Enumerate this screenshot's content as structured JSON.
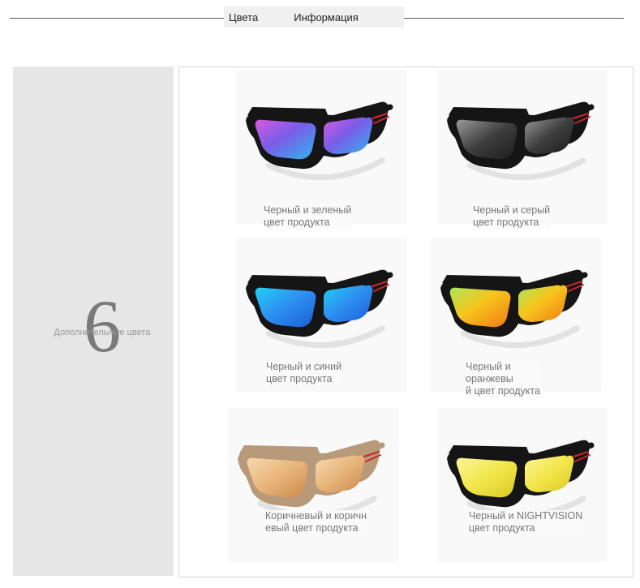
{
  "tabs": [
    "Цвета",
    "Информация"
  ],
  "side": {
    "count": "6",
    "caption": "Дополнительные цвета"
  },
  "products": [
    {
      "line1": "Черный и зеленый",
      "line2": "цвет продукта",
      "line3": "",
      "frame": "#151515",
      "lens": "purple-blue"
    },
    {
      "line1": "Черный и серый",
      "line2": "цвет продукта",
      "line3": "",
      "frame": "#151515",
      "lens": "grey"
    },
    {
      "line1": "Черный и синий",
      "line2": "цвет продукта",
      "line3": "",
      "frame": "#151515",
      "lens": "blue"
    },
    {
      "line1": "Черный и",
      "line2": "оранжевы",
      "line3": "й цвет продукта",
      "frame": "#151515",
      "lens": "orange"
    },
    {
      "line1": "Коричневый и коричн",
      "line2": "евый цвет продукта",
      "line3": "",
      "frame": "#b89a7a",
      "lens": "tan"
    },
    {
      "line1": "Черный и NIGHTVISION",
      "line2": "цвет продукта",
      "line3": "",
      "frame": "#151515",
      "lens": "yellow"
    }
  ],
  "colors": {
    "accent_red": "#c8262c",
    "side_bg": "#e6e6e6",
    "header_bg": "#f0f0f0"
  }
}
